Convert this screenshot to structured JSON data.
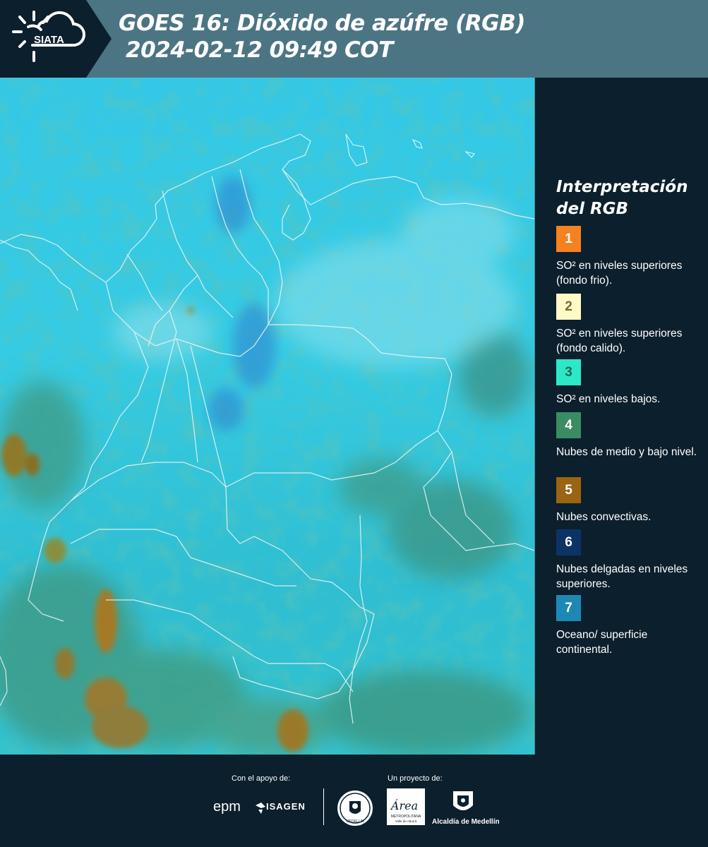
{
  "header": {
    "logo_text": "SIATA",
    "title_line1": "GOES 16: Dióxido de azúfre (RGB)",
    "title_line2": "2024-02-12 09:49 COT"
  },
  "legend": {
    "title_line1": "Interpretación",
    "title_line2": "del RGB",
    "items": [
      {
        "num": "1",
        "text": "SO² en niveles superiores (fondo frio).",
        "color": "#f6821f"
      },
      {
        "num": "2",
        "text": "SO² en niveles superiores (fondo calido).",
        "color": "#fff9c8"
      },
      {
        "num": "3",
        "text": "SO² en niveles bajos.",
        "color": "#2de8c6"
      },
      {
        "num": "4",
        "text": "Nubes de medio y bajo nivel.",
        "color": "#3a8c62"
      },
      {
        "num": "5",
        "text": "Nubes convectivas.",
        "color": "#9a6412"
      },
      {
        "num": "6",
        "text": "Nubes delgadas en niveles superiores.",
        "color": "#0c3366"
      },
      {
        "num": "7",
        "text": "Oceano/ superficie continental.",
        "color": "#1e88b4"
      }
    ]
  },
  "footer": {
    "support_label": "Con el apoyo de:",
    "project_label": "Un proyecto de:",
    "epm_text": "epm",
    "isagen_text": "ISAGEN",
    "medellin_seal_text": "MEDELLIN",
    "area_text": "Área",
    "area_subtext": "METROPOLITANA",
    "area_subtext2": "Valle de Aburrá",
    "alcaldia_text": "Alcaldía de Medellín"
  }
}
